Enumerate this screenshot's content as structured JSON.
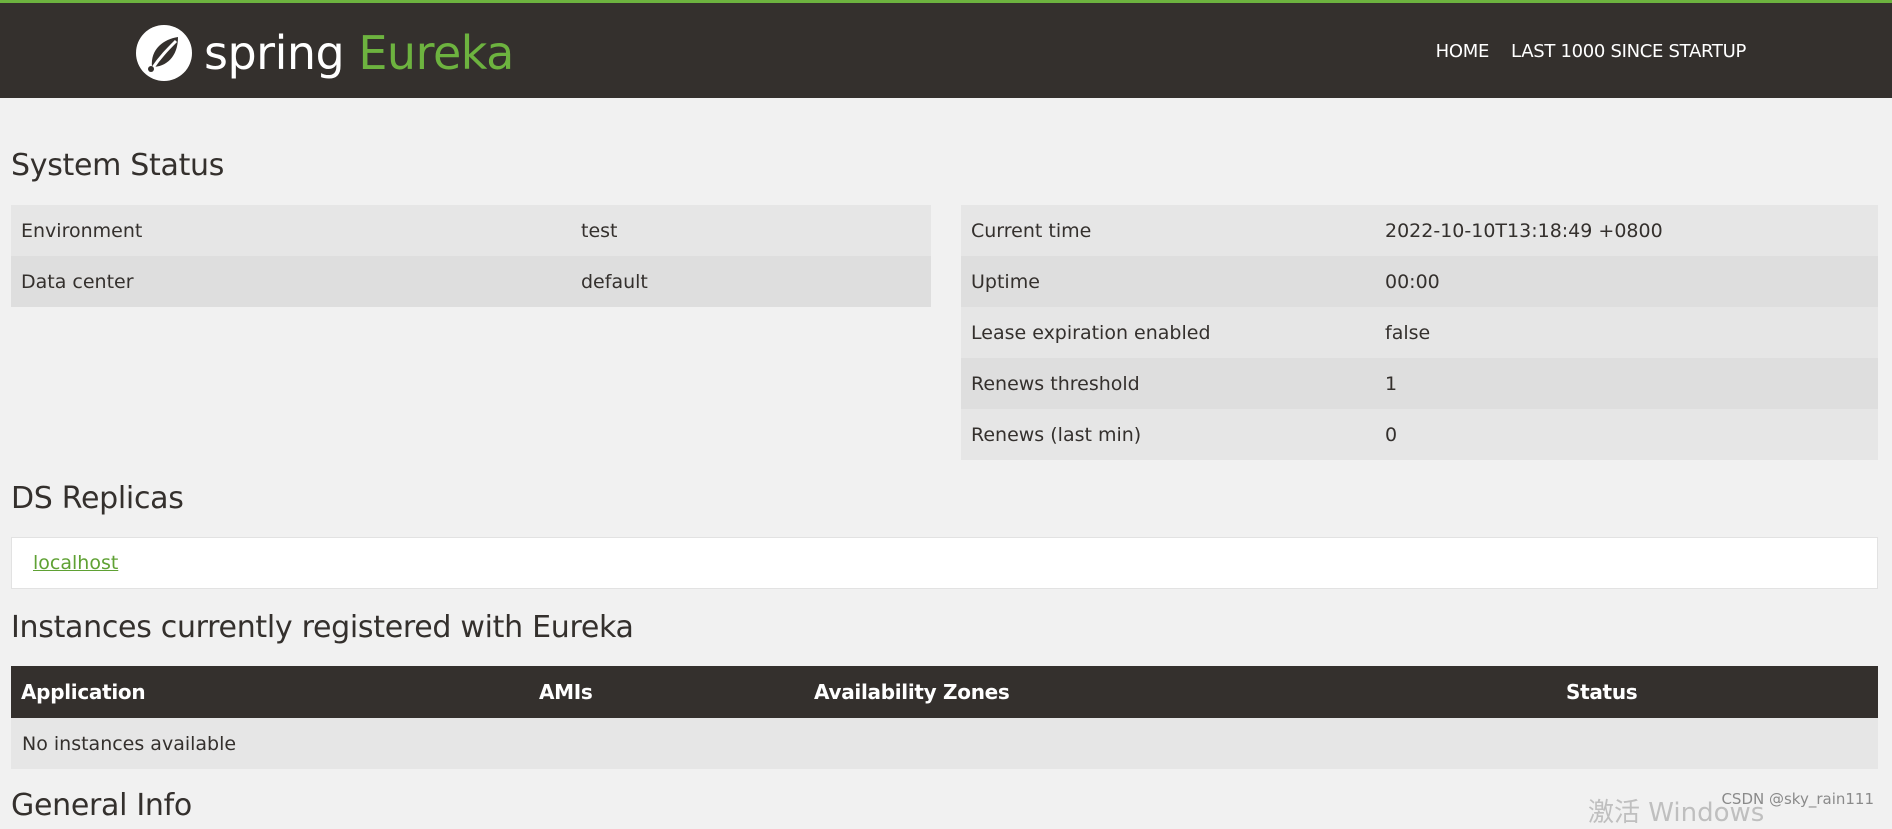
{
  "header": {
    "logo_word1": "spring",
    "logo_word2": "Eureka",
    "nav": [
      "HOME",
      "LAST 1000 SINCE STARTUP"
    ]
  },
  "system_status": {
    "title": "System Status",
    "left": [
      {
        "label": "Environment",
        "value": "test"
      },
      {
        "label": "Data center",
        "value": "default"
      }
    ],
    "right": [
      {
        "label": "Current time",
        "value": "2022-10-10T13:18:49 +0800"
      },
      {
        "label": "Uptime",
        "value": "00:00"
      },
      {
        "label": "Lease expiration enabled",
        "value": "false"
      },
      {
        "label": "Renews threshold",
        "value": "1"
      },
      {
        "label": "Renews (last min)",
        "value": "0"
      }
    ]
  },
  "ds_replicas": {
    "title": "DS Replicas",
    "link": "localhost"
  },
  "instances": {
    "title": "Instances currently registered with Eureka",
    "columns": [
      "Application",
      "AMIs",
      "Availability Zones",
      "Status"
    ],
    "empty_text": "No instances available"
  },
  "general_info": {
    "title": "General Info"
  },
  "overlay": {
    "watermark": "激活 Windows",
    "credit": "CSDN @sky_rain111"
  },
  "colors": {
    "header_bg": "#34302d",
    "accent_green": "#6db33f",
    "page_bg": "#f1f1f1"
  }
}
